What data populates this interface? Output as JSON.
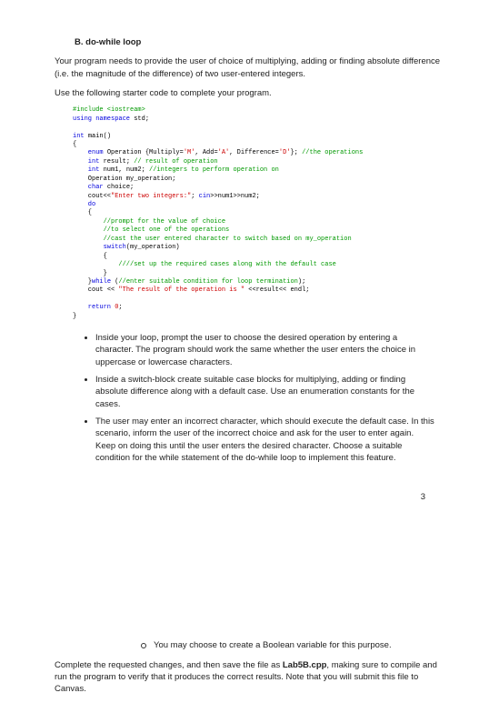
{
  "section": {
    "label": "B.",
    "title": "do-while loop"
  },
  "intro1": "Your program needs to provide the user of choice of multiplying, adding or finding absolute difference (i.e. the magnitude of the difference) of two user-entered integers.",
  "intro2": "Use the following starter code to complete your program.",
  "code": {
    "l1": "#include <iostream>",
    "l2": "using namespace ",
    "l2b": "std;",
    "l3": "int ",
    "l3b": "main()",
    "l4": "{",
    "l5": "    enum ",
    "l5a": "Operation {Multiply=",
    "l5b": "'M'",
    "l5c": ", Add=",
    "l5d": "'A'",
    "l5e": ", Difference=",
    "l5f": "'D'",
    "l5g": "}; ",
    "l5h": "//the operations",
    "l6": "    int ",
    "l6a": "result; ",
    "l6b": "// result of operation",
    "l7": "    int ",
    "l7a": "num1, num2; ",
    "l7b": "//integers to perform operation on",
    "l8": "    Operation my_operation;",
    "l9": "    char ",
    "l9a": "choice;",
    "l10": "    cout<<",
    "l10a": "\"Enter two integers:\"",
    "l10b": "; ",
    "l10c": "cin",
    "l10d": ">>num1>>num2;",
    "l11": "    do",
    "l12": "    {",
    "l13": "        //prompt for the value of choice",
    "l14": "        //to select one of the operations",
    "l15": "        //cast the user entered character to switch based on my_operation",
    "l16": "        switch",
    "l16a": "(my_operation)",
    "l17": "        {",
    "l18": "            ////set up the required cases along with the default case",
    "l19": "        }",
    "l20": "    }",
    "l20a": "while ",
    "l20b": "(",
    "l20c": "//enter suitable condition for loop termination",
    "l20d": ");",
    "l21": "    cout ",
    "l21a": "<< ",
    "l21b": "\"The result of the operation is \" ",
    "l21c": "<<result<< ",
    "l21d": "endl;",
    "l22": "    return ",
    "l22a": "0",
    "l22b": ";",
    "l23": "}"
  },
  "bullets": [
    "Inside your loop, prompt the user to choose the desired operation by entering a character. The program should work the same whether the user enters the choice in uppercase or lowercase characters.",
    "Inside a switch-block create suitable case blocks for multiplying, adding or finding absolute difference along with a default case. Use an enumeration constants  for the cases.",
    "The user may enter an incorrect character, which should execute the default case. In this scenario, inform the user of the incorrect choice and ask for the user to enter again. Keep on doing this until the user enters the desired character. Choose a suitable condition for the while statement of the do-while loop to implement this feature."
  ],
  "pagenum": "3",
  "subbullet": "You may choose to create  a Boolean variable for this purpose.",
  "final": {
    "t1": "Complete the requested changes, and then save the file as ",
    "t2": "Lab5B.cpp",
    "t3": ", making sure to compile and run the program to verify that it produces the correct results. Note that you will submit this file to Canvas."
  }
}
